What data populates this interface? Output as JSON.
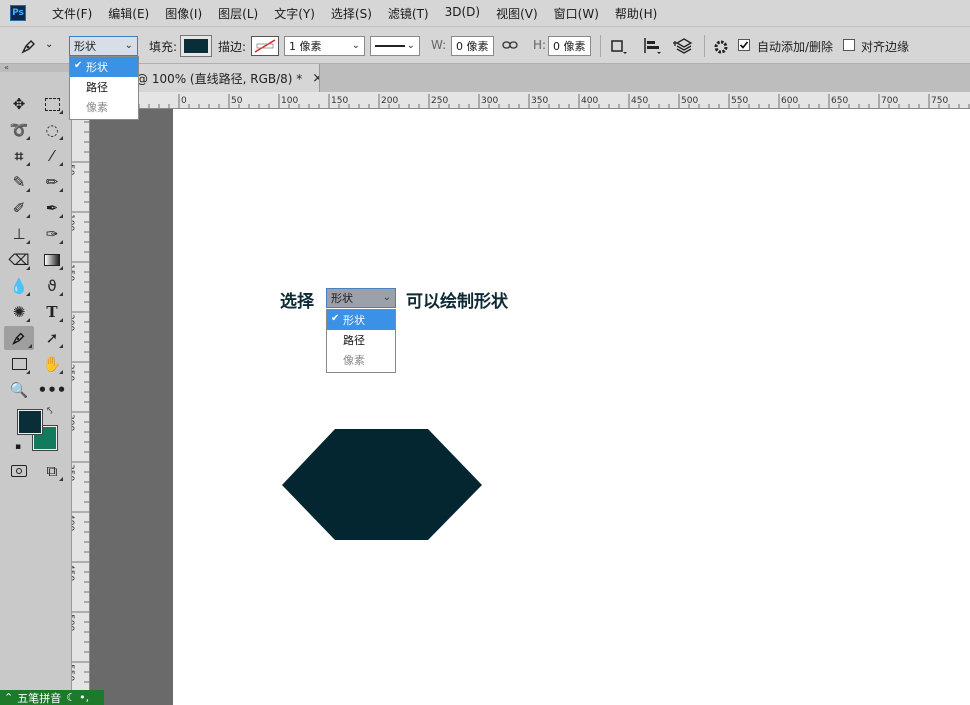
{
  "app": {
    "logo_text": "Ps"
  },
  "menubar": {
    "items": [
      {
        "label": "文件(F)"
      },
      {
        "label": "编辑(E)"
      },
      {
        "label": "图像(I)"
      },
      {
        "label": "图层(L)"
      },
      {
        "label": "文字(Y)"
      },
      {
        "label": "选择(S)"
      },
      {
        "label": "滤镜(T)"
      },
      {
        "label": "3D(D)"
      },
      {
        "label": "视图(V)"
      },
      {
        "label": "窗口(W)"
      },
      {
        "label": "帮助(H)"
      }
    ]
  },
  "options": {
    "mode_value": "形状",
    "fill_label": "填充:",
    "fill_color": "#0a2e38",
    "stroke_label": "描边:",
    "stroke_width_value": "1 像素",
    "w_label": "W:",
    "w_value": "0 像素",
    "h_label": "H:",
    "h_value": "0 像素",
    "auto_add_delete_label": "自动添加/删除",
    "auto_add_delete_checked": true,
    "align_edges_label": "对齐边缘",
    "align_edges_checked": false
  },
  "mode_dropdown": {
    "items": [
      {
        "label": "形状",
        "state": "selected"
      },
      {
        "label": "路径",
        "state": "normal"
      },
      {
        "label": "像素",
        "state": "disabled"
      }
    ]
  },
  "document": {
    "tab_title": "@ 100% (直线路径, RGB/8) *",
    "close_glyph": "×"
  },
  "ruler": {
    "h_labels": [
      "0",
      "50",
      "100",
      "150",
      "200",
      "250",
      "300",
      "350",
      "400",
      "450",
      "500",
      "550",
      "600",
      "650",
      "700",
      "750"
    ],
    "v_labels": [
      "0",
      "50",
      "100",
      "150",
      "200",
      "250",
      "300",
      "350",
      "400",
      "450",
      "500",
      "550"
    ]
  },
  "annotation": {
    "prefix": "选择",
    "select_value": "形状",
    "suffix": "可以绘制形状",
    "items": [
      {
        "label": "形状",
        "state": "selected"
      },
      {
        "label": "路径",
        "state": "normal"
      },
      {
        "label": "像素",
        "state": "disabled"
      }
    ]
  },
  "shape": {
    "fill": "#032630"
  },
  "colors": {
    "foreground": "#0a2e38",
    "background": "#147a5e",
    "accent": "#3b91e6"
  },
  "ime": {
    "label": "五笔拼音"
  },
  "icons": [
    "pen-tool-icon",
    "move-icon",
    "marquee-icon",
    "lasso-icon",
    "quick-select-icon",
    "crop-icon",
    "eyedropper-icon",
    "brush-icon",
    "pencil-icon",
    "healing-icon",
    "clone-stamp-icon",
    "history-brush-icon",
    "eraser-icon",
    "gradient-icon",
    "blur-icon",
    "smudge-icon",
    "sponge-icon",
    "type-icon",
    "pen-icon",
    "path-select-icon",
    "rectangle-icon",
    "hand-icon",
    "zoom-icon",
    "more-icon",
    "gear-icon",
    "link-icon"
  ]
}
